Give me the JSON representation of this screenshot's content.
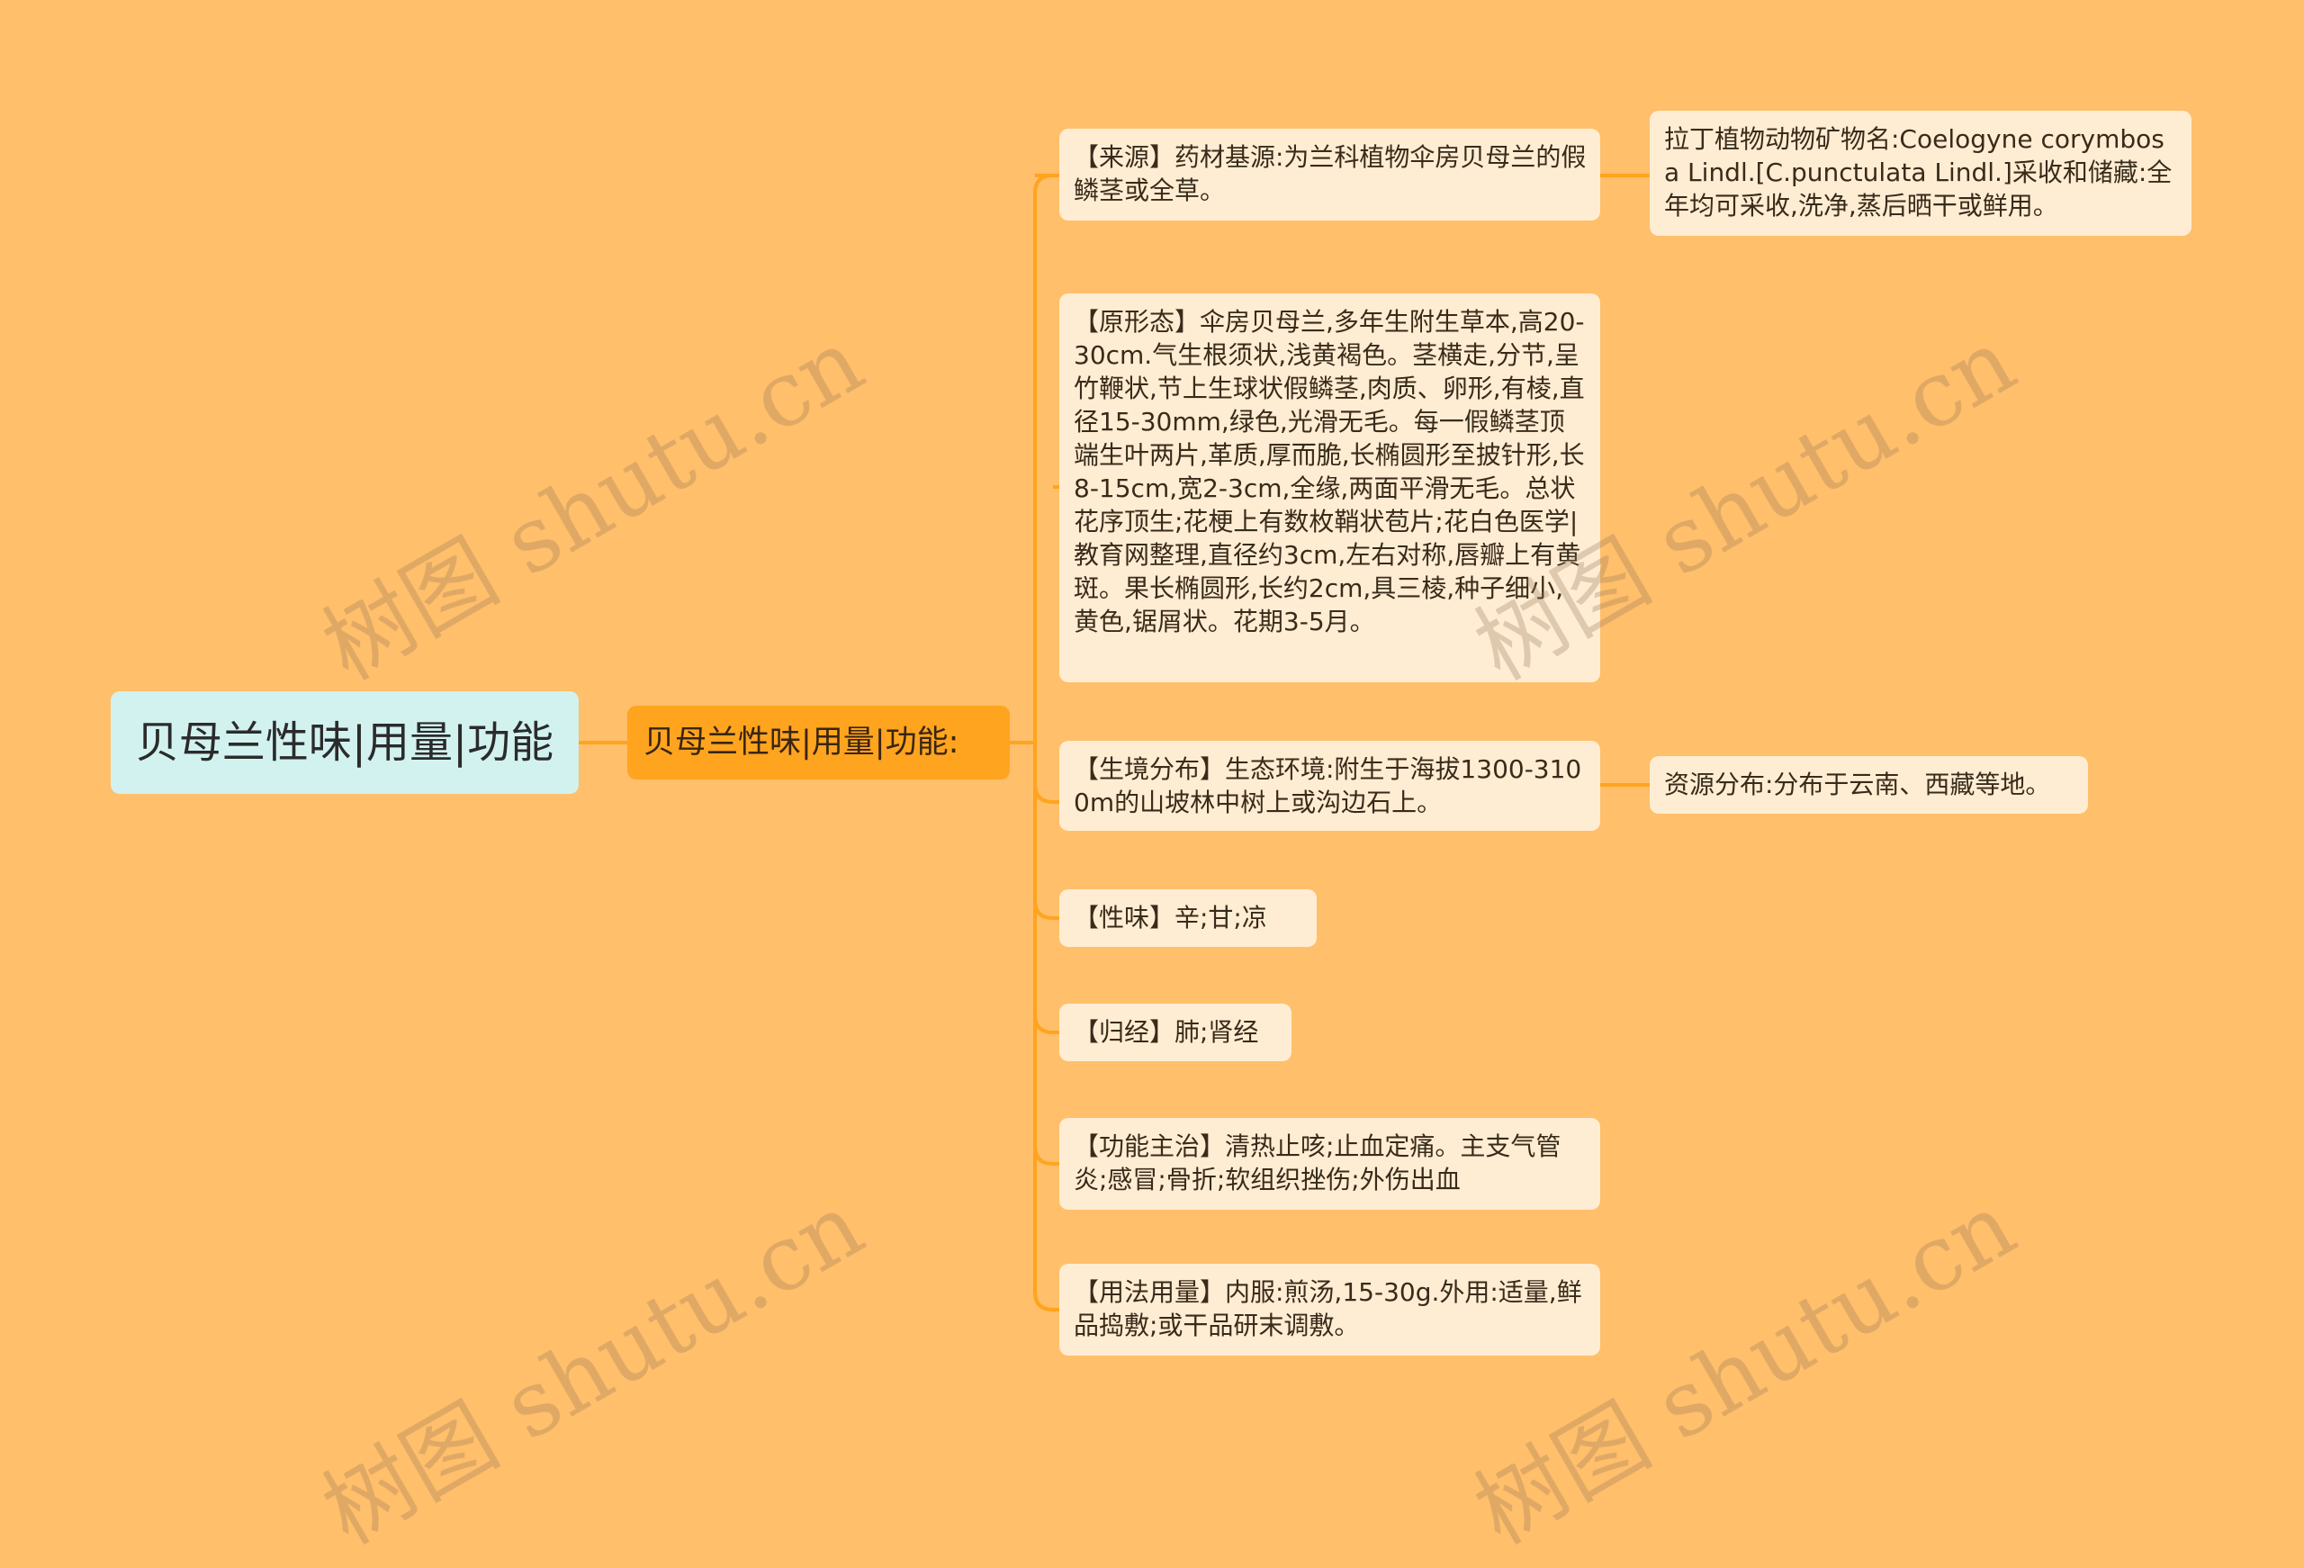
{
  "root": {
    "label": "贝母兰性味|用量|功能"
  },
  "center": {
    "label": "贝母兰性味|用量|功能:"
  },
  "branches": [
    {
      "text": "【来源】药材基源:为兰科植物伞房贝母兰的假鳞茎或全草。"
    },
    {
      "text": "【原形态】伞房贝母兰,多年生附生草本,高20-30cm.气生根须状,浅黄褐色。茎横走,分节,呈竹鞭状,节上生球状假鳞茎,肉质、卵形,有棱,直径15-30mm,绿色,光滑无毛。每一假鳞茎顶端生叶两片,革质,厚而脆,长椭圆形至披针形,长8-15cm,宽2-3cm,全缘,两面平滑无毛。总状花序顶生;花梗上有数枚鞘状苞片;花白色医学|教育网整理,直径约3cm,左右对称,唇瓣上有黄斑。果长椭圆形,长约2cm,具三棱,种子细小,黄色,锯屑状。花期3-5月。"
    },
    {
      "text": "【生境分布】生态环境:附生于海拔1300-3100m的山坡林中树上或沟边石上。"
    },
    {
      "text": "【性味】辛;甘;凉"
    },
    {
      "text": "【归经】肺;肾经"
    },
    {
      "text": "【功能主治】清热止咳;止血定痛。主支气管炎;感冒;骨折;软组织挫伤;外伤出血"
    },
    {
      "text": "【用法用量】内服:煎汤,15-30g.外用:适量,鲜品捣敷;或干品研末调敷。"
    }
  ],
  "subnodes": [
    {
      "text": "拉丁植物动物矿物名:Coelogyne corymbosa Lindl.[C.punctulata Lindl.]采收和储藏:全年均可采收,洗净,蒸后晒干或鲜用。"
    },
    {
      "text": "资源分布:分布于云南、西藏等地。"
    }
  ],
  "watermark": "树图 shutu.cn",
  "colors": {
    "background": "#FFBF6B",
    "line": "#FFA41F",
    "leaf": "#FFEDD3",
    "center": "#FFA41F",
    "root": "#D2F2F0"
  }
}
